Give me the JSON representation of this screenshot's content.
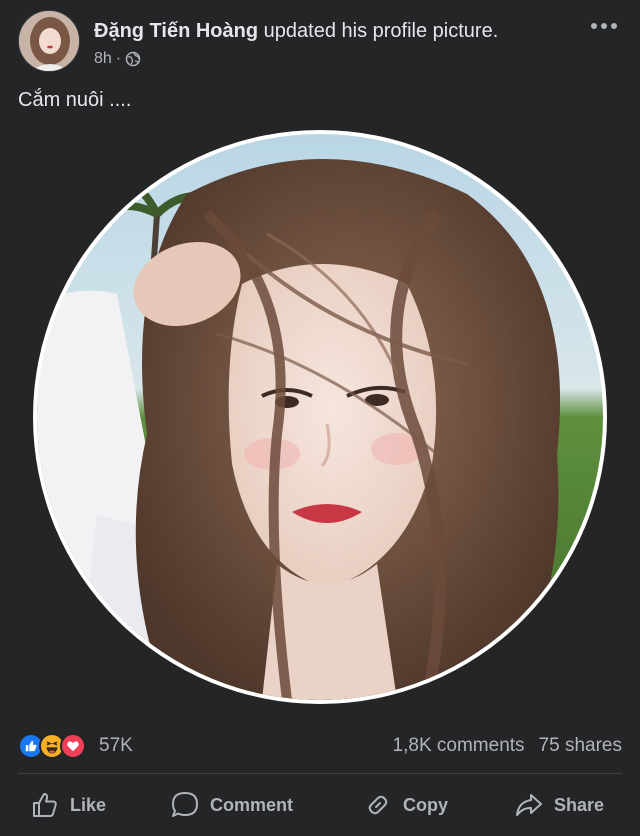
{
  "post": {
    "author": "Đặng Tiến Hoàng",
    "action": "updated his profile picture.",
    "time": "8h",
    "privacy_separator": "·",
    "privacy_icon": "globe-icon",
    "caption": "Cắm nuôi ....",
    "more_icon": "more-dots-icon"
  },
  "reactions": {
    "icons": [
      "like-reaction-icon",
      "haha-reaction-icon",
      "love-reaction-icon"
    ],
    "count": "57K",
    "comments": "1,8K comments",
    "shares": "75 shares"
  },
  "actions": {
    "like": "Like",
    "comment": "Comment",
    "copy": "Copy",
    "share": "Share"
  },
  "colors": {
    "background": "#242526",
    "text_primary": "#e4e6eb",
    "text_secondary": "#b0b3b8",
    "like_blue": "#1877f2",
    "love_red": "#f33e58",
    "haha_yellow": "#f7b125"
  }
}
